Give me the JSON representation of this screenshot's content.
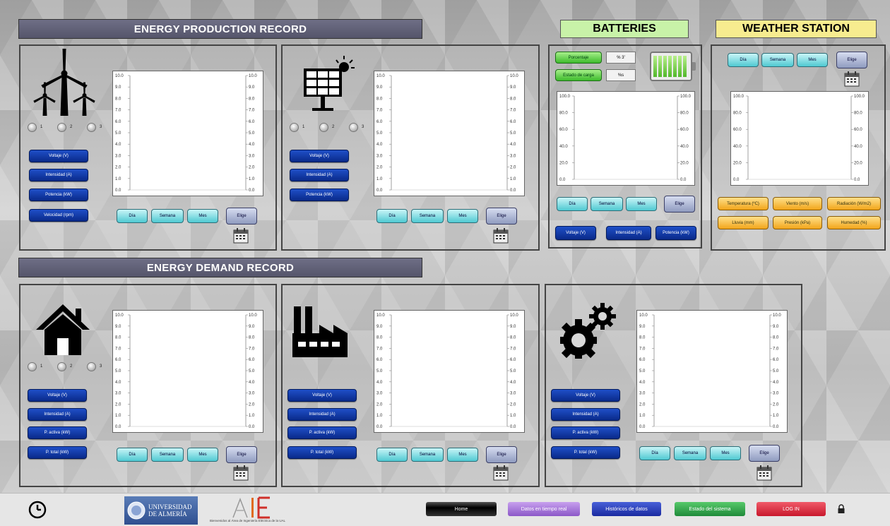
{
  "sections": {
    "production_title": "ENERGY PRODUCTION RECORD",
    "demand_title": "ENERGY DEMAND RECORD",
    "batteries_title": "BATTERIES",
    "weather_title": "WEATHER STATION"
  },
  "colors": {
    "batteries_header": "#c8f2a8",
    "weather_header": "#f7ec8f",
    "nav_home": "#111111",
    "nav_realtime": "#8c57c8",
    "nav_historic": "#1a2aa0",
    "nav_status": "#1f8a3a",
    "nav_login": "#c8182c"
  },
  "chart_axis": {
    "ticks_10": [
      "10.0",
      "9.0",
      "8.0",
      "7.0",
      "6.0",
      "5.0",
      "4.0",
      "3.0",
      "2.0",
      "1.0",
      "0.0"
    ],
    "ticks_100": [
      "100.0",
      "80.0",
      "60.0",
      "40.0",
      "20.0",
      "0.0"
    ]
  },
  "radio_labels": [
    "1",
    "2",
    "3"
  ],
  "period_buttons": {
    "day": "Día",
    "week": "Semana",
    "month": "Mes",
    "choose": "Elige"
  },
  "wind": {
    "icon": "wind-turbine-icon",
    "buttons": [
      "Voltaje (V)",
      "Intensidad (A)",
      "Potencia (kW)",
      "Velocidad (rpm)"
    ]
  },
  "solar": {
    "icon": "solar-panel-icon",
    "buttons": [
      "Voltaje (V)",
      "Intensidad (A)",
      "Potencia (kW)"
    ]
  },
  "batteries": {
    "percentage_label": "Porcentaje",
    "percentage_value": "% 3'",
    "charge_state_label": "Estado de carga",
    "charge_state_value": "%s",
    "buttons": [
      "Voltaje (V)",
      "Intensidad (A)",
      "Potencia (kW)"
    ]
  },
  "weather": {
    "buttons": [
      "Temperatura (ºC)",
      "Viento (m/s)",
      "Radiación (W/m2)",
      "Lluvia (mm)",
      "Presión (kPa)",
      "Humedad (%)"
    ]
  },
  "house": {
    "icon": "house-icon",
    "buttons": [
      "Voltaje (V)",
      "Intensidad (A)",
      "P. activa (kW)",
      "P. total (kW)"
    ]
  },
  "factory": {
    "icon": "factory-icon",
    "buttons": [
      "Voltaje (V)",
      "Intensidad (A)",
      "P. activa (kW)",
      "P. total (kW)"
    ]
  },
  "gears": {
    "icon": "gears-icon",
    "buttons": [
      "Voltaje (V)",
      "Intensidad (A)",
      "P. activa (kW)",
      "P. total (kW)"
    ]
  },
  "footer": {
    "university": "UNIVERSIDAD DE ALMERÍA",
    "aie_tagline": "Bienvenidos al Área de Ingeniería Eléctrica de la UAL",
    "nav": [
      "Home",
      "Datos en tiempo real",
      "Históricos de datos",
      "Estado del sistema",
      "LOG IN"
    ]
  }
}
